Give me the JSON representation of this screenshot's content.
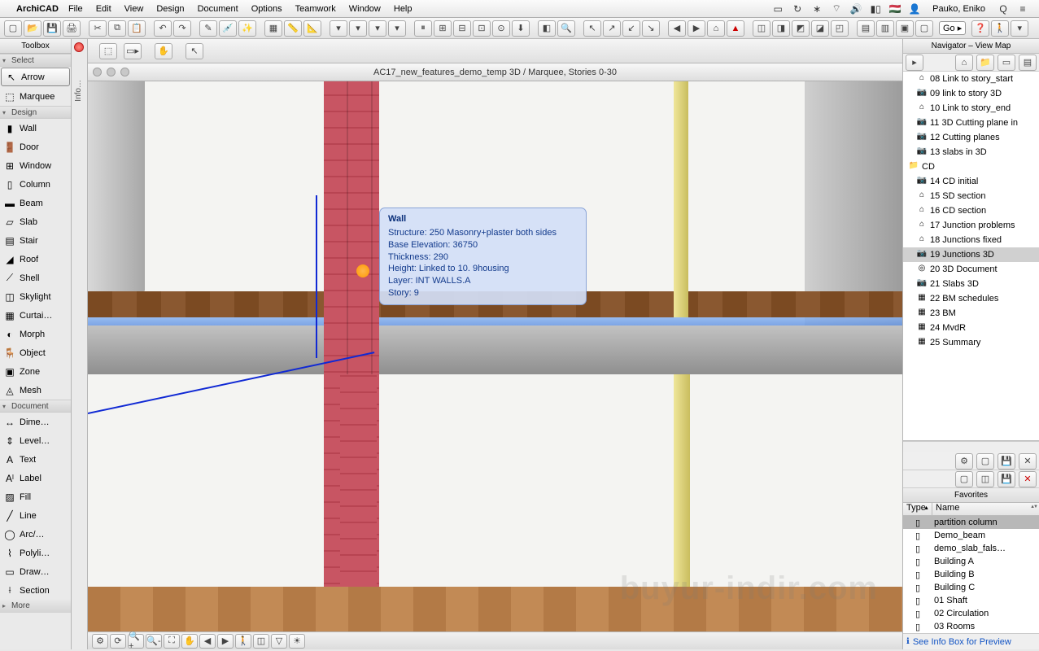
{
  "menubar": {
    "app": "ArchiCAD",
    "items": [
      "File",
      "Edit",
      "View",
      "Design",
      "Document",
      "Options",
      "Teamwork",
      "Window",
      "Help"
    ],
    "user": "Pauko, Eniko"
  },
  "toolbar": {
    "go_label": "Go"
  },
  "toolbox": {
    "title": "Toolbox",
    "sections": {
      "select": "Select",
      "design": "Design",
      "document": "Document",
      "more": "More"
    },
    "select_tools": [
      {
        "label": "Arrow",
        "key": "arrow"
      },
      {
        "label": "Marquee",
        "key": "marquee"
      }
    ],
    "design_tools": [
      {
        "label": "Wall"
      },
      {
        "label": "Door"
      },
      {
        "label": "Window"
      },
      {
        "label": "Column"
      },
      {
        "label": "Beam"
      },
      {
        "label": "Slab"
      },
      {
        "label": "Stair"
      },
      {
        "label": "Roof"
      },
      {
        "label": "Shell"
      },
      {
        "label": "Skylight"
      },
      {
        "label": "Curtai…"
      },
      {
        "label": "Morph"
      },
      {
        "label": "Object"
      },
      {
        "label": "Zone"
      },
      {
        "label": "Mesh"
      }
    ],
    "document_tools": [
      {
        "label": "Dime…"
      },
      {
        "label": "Level…"
      },
      {
        "label": "Text"
      },
      {
        "label": "Label"
      },
      {
        "label": "Fill"
      },
      {
        "label": "Line"
      },
      {
        "label": "Arc/…"
      },
      {
        "label": "Polyli…"
      },
      {
        "label": "Draw…"
      },
      {
        "label": "Section"
      }
    ]
  },
  "info_tab": "Info…",
  "viewport": {
    "window_title": "AC17_new_features_demo_temp 3D / Marquee, Stories 0-30"
  },
  "tooltip": {
    "title": "Wall",
    "lines": [
      "Structure: 250 Masonry+plaster both sides",
      "Base Elevation: 36750",
      "Thickness: 290",
      "Height: Linked to 10. 9housing",
      "Layer: INT WALLS.A",
      "Story: 9"
    ]
  },
  "navigator": {
    "title": "Navigator – View Map",
    "items": [
      {
        "label": "08 Link to story_start",
        "icon": "⌂"
      },
      {
        "label": "09 link to story 3D",
        "icon": "📷"
      },
      {
        "label": "10 Link to story_end",
        "icon": "⌂"
      },
      {
        "label": "11 3D Cutting plane in",
        "icon": "📷"
      },
      {
        "label": "12 Cutting planes",
        "icon": "📷"
      },
      {
        "label": "13 slabs in 3D",
        "icon": "📷"
      },
      {
        "label": "CD",
        "icon": "📁",
        "folder": true
      },
      {
        "label": "14 CD initial",
        "icon": "📷"
      },
      {
        "label": "15 SD section",
        "icon": "⌂"
      },
      {
        "label": "16 CD section",
        "icon": "⌂"
      },
      {
        "label": "17 Junction problems",
        "icon": "⌂"
      },
      {
        "label": "18 Junctions fixed",
        "icon": "⌂"
      },
      {
        "label": "19 Junctions 3D",
        "icon": "📷",
        "sel": true
      },
      {
        "label": "20 3D Document",
        "icon": "◎"
      },
      {
        "label": "21 Slabs 3D",
        "icon": "📷"
      },
      {
        "label": "22 BM schedules",
        "icon": "▦"
      },
      {
        "label": "23 BM",
        "icon": "▦"
      },
      {
        "label": "24 MvdR",
        "icon": "▦"
      },
      {
        "label": "25 Summary",
        "icon": "▦"
      }
    ]
  },
  "favorites": {
    "title": "Favorites",
    "col_type": "Type",
    "col_name": "Name",
    "rows": [
      {
        "name": "partition column",
        "sel": true
      },
      {
        "name": "Demo_beam"
      },
      {
        "name": "demo_slab_fals…"
      },
      {
        "name": "Building A"
      },
      {
        "name": "Building B"
      },
      {
        "name": "Building C"
      },
      {
        "name": "01 Shaft"
      },
      {
        "name": "02 Circulation"
      },
      {
        "name": "03 Rooms"
      }
    ],
    "hint": "See Info Box for Preview"
  },
  "watermark": "buyur-indir.com"
}
